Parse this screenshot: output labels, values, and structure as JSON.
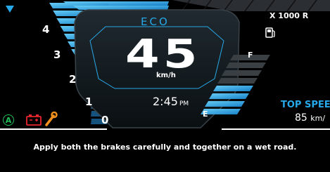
{
  "header": {
    "rpm_unit_label": "X 1000 R"
  },
  "tachometer": {
    "scale_labels": [
      "4",
      "3",
      "2",
      "1",
      "0"
    ]
  },
  "center": {
    "riding_mode": "ECO",
    "speed": "45",
    "speed_unit": "km/h",
    "clock_time": "2:45",
    "clock_ampm": "PM"
  },
  "fuel": {
    "full_label": "F",
    "empty_label": "E"
  },
  "top_speed": {
    "label": "TOP SPEE",
    "value": "85",
    "unit": "km/"
  },
  "message": "Apply both the brakes carefully and together on a wet road.",
  "colors": {
    "accent_blue": "#27a8e8",
    "warning_red": "#e8262b",
    "service_orange": "#f2901e",
    "indicator_green": "#22c05a"
  },
  "icons": [
    "menu-triangle-icon",
    "fuel-pump-icon",
    "abs-indicator-icon",
    "battery-warning-icon",
    "service-wrench-icon"
  ]
}
